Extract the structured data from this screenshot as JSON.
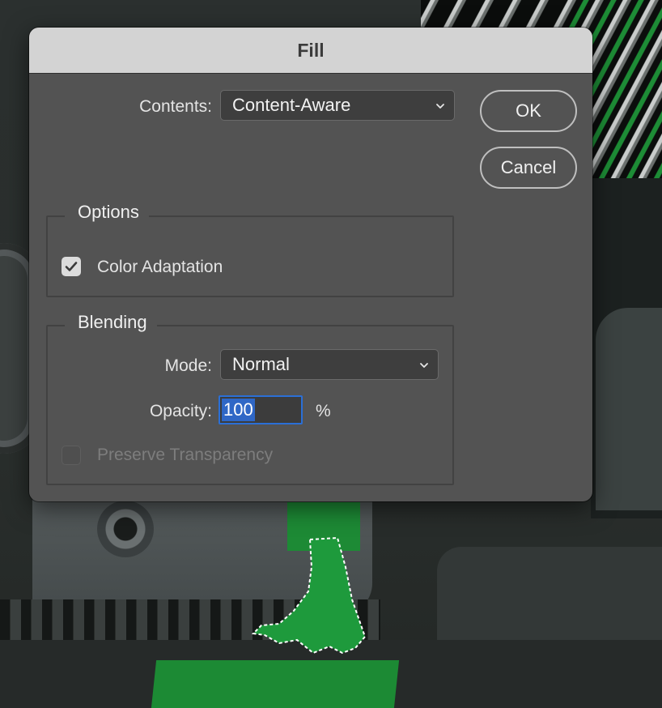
{
  "dialog": {
    "title": "Fill",
    "contents": {
      "label": "Contents:",
      "value": "Content-Aware"
    },
    "buttons": {
      "ok": "OK",
      "cancel": "Cancel"
    },
    "options": {
      "legend": "Options",
      "color_adaptation": {
        "label": "Color Adaptation",
        "checked": true
      }
    },
    "blending": {
      "legend": "Blending",
      "mode": {
        "label": "Mode:",
        "value": "Normal"
      },
      "opacity": {
        "label": "Opacity:",
        "value": "100",
        "unit": "%"
      },
      "preserve_transparency": {
        "label": "Preserve Transparency",
        "checked": false,
        "enabled": false
      }
    }
  },
  "colors": {
    "dialog_bg": "#535353",
    "titlebar_bg": "#d3d3d3",
    "focus_accent": "#2b6fd6",
    "selection_highlight": "#2f67c6"
  },
  "icons": {
    "select_arrow": "chevron-down-icon",
    "checked": "checkmark-icon"
  }
}
